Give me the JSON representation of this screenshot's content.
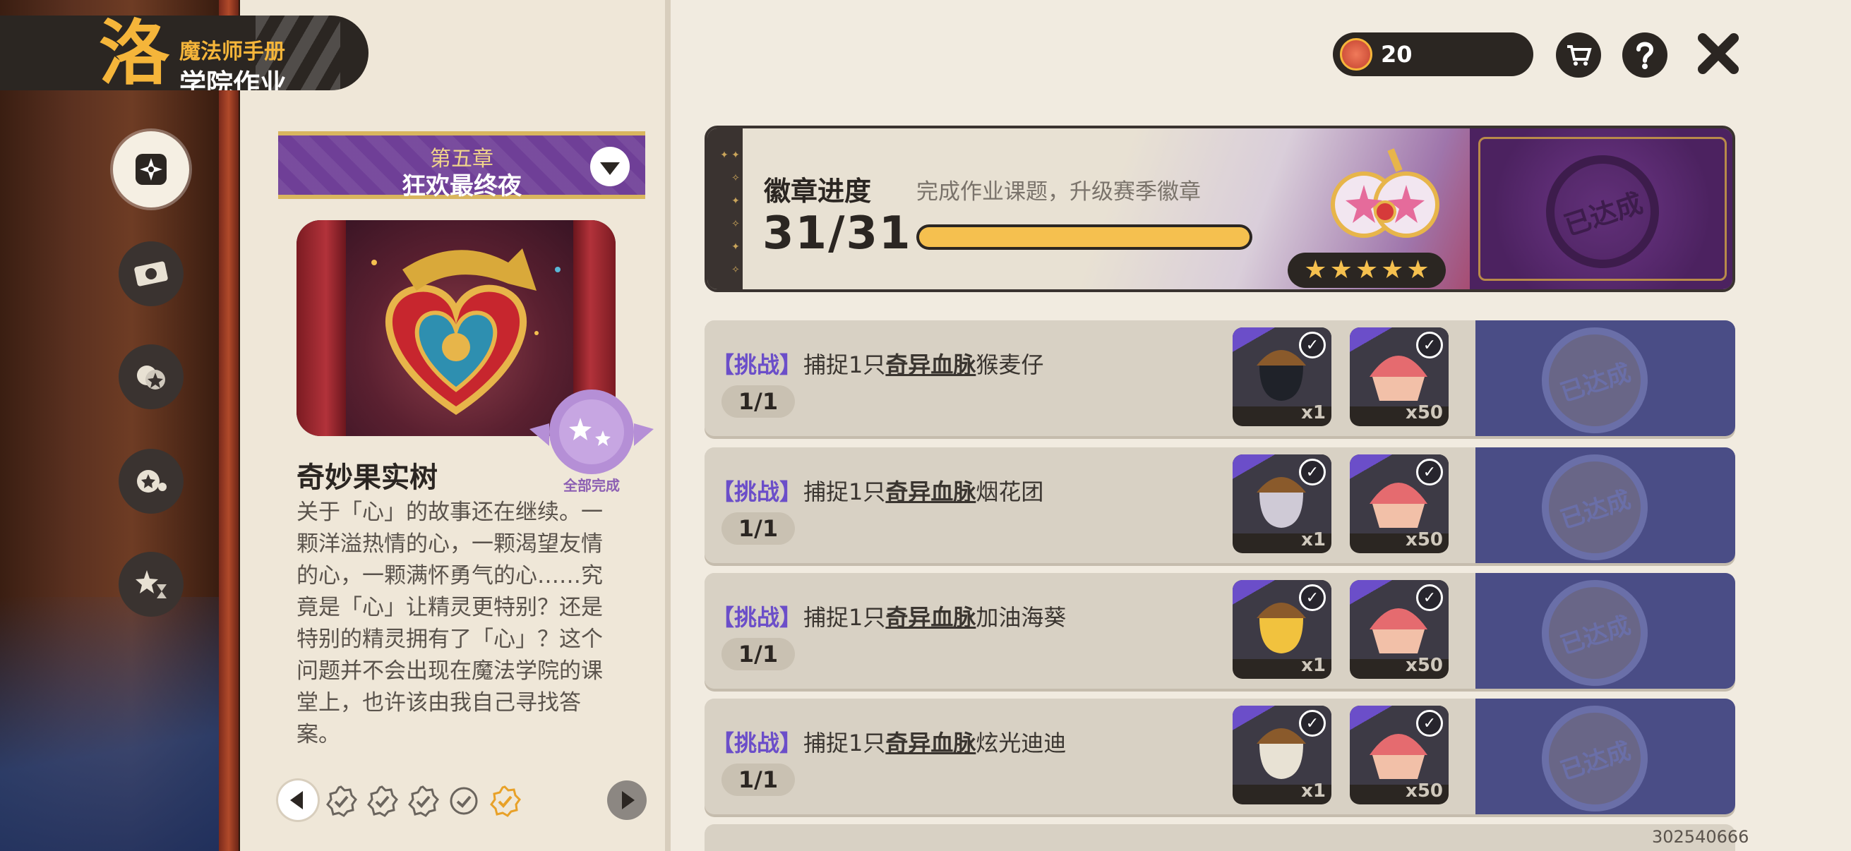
{
  "app": {
    "title_sub": "魔法师手册",
    "title_main": "学院作业",
    "logo_char": "洛"
  },
  "sidebar": {
    "items": [
      {
        "name": "homework",
        "active": true
      },
      {
        "name": "tickets",
        "active": false
      },
      {
        "name": "spirits",
        "active": false
      },
      {
        "name": "skills",
        "active": false
      },
      {
        "name": "achievements",
        "active": false
      }
    ]
  },
  "chapter": {
    "sub": "第五章",
    "main": "狂欢最终夜"
  },
  "detail": {
    "name": "奇妙果实树",
    "seal_label": "全部完成",
    "description": "关于「心」的故事还在继续。一颗洋溢热情的心，一颗渴望友情的心，一颗满怀勇气的心……究竟是「心」让精灵更特别？还是特别的精灵拥有了「心」？这个问题并不会出现在魔法学院的课堂上，也许该由我自己寻找答案。"
  },
  "currency": {
    "amount": "20"
  },
  "badge": {
    "title": "徽章进度",
    "subtitle": "完成作业课题，升级赛季徽章",
    "count": "31/31",
    "progress": 1.0,
    "stars": 5,
    "stamp": "已达成"
  },
  "tasks": [
    {
      "tag": "【挑战】",
      "prefix": "捕捉1只",
      "highlight": "奇异血脉",
      "target": "猴麦仔",
      "progress": "1/1",
      "rewards": [
        {
          "qty": "x1",
          "color": "#1f2229"
        },
        {
          "qty": "x50",
          "color": "#e56b6f"
        }
      ],
      "stamp": "已达成"
    },
    {
      "tag": "【挑战】",
      "prefix": "捕捉1只",
      "highlight": "奇异血脉",
      "target": "烟花团",
      "progress": "1/1",
      "rewards": [
        {
          "qty": "x1",
          "color": "#cfcad6"
        },
        {
          "qty": "x50",
          "color": "#e56b6f"
        }
      ],
      "stamp": "已达成"
    },
    {
      "tag": "【挑战】",
      "prefix": "捕捉1只",
      "highlight": "奇异血脉",
      "target": "加油海葵",
      "progress": "1/1",
      "rewards": [
        {
          "qty": "x1",
          "color": "#f1c23e"
        },
        {
          "qty": "x50",
          "color": "#e56b6f"
        }
      ],
      "stamp": "已达成"
    },
    {
      "tag": "【挑战】",
      "prefix": "捕捉1只",
      "highlight": "奇异血脉",
      "target": "炫光迪迪",
      "progress": "1/1",
      "rewards": [
        {
          "qty": "x1",
          "color": "#e8e2d4"
        },
        {
          "qty": "x50",
          "color": "#e56b6f"
        }
      ],
      "stamp": "已达成"
    }
  ],
  "watermark": "302540666",
  "colors": {
    "accent_purple": "#6f3f97",
    "gold": "#f5c04f",
    "dark": "#2b2622",
    "done_blue": "#4a4d86"
  }
}
